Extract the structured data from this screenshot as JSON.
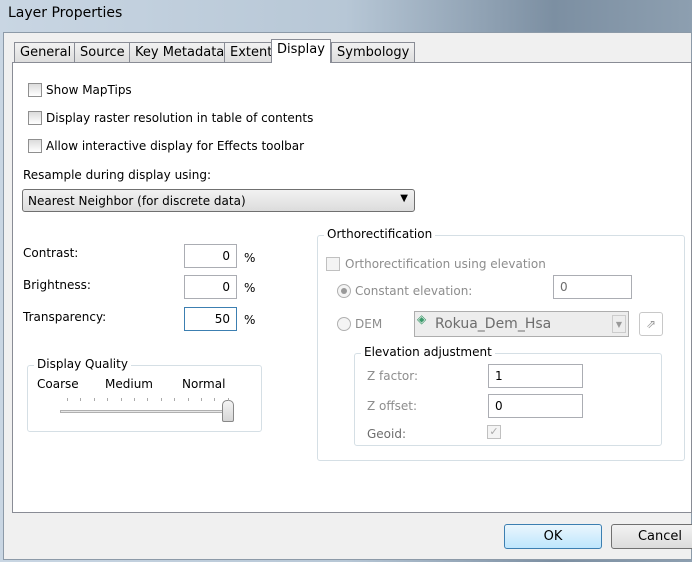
{
  "window": {
    "title": "Layer Properties"
  },
  "tabs": [
    {
      "label": "General"
    },
    {
      "label": "Source"
    },
    {
      "label": "Key Metadata"
    },
    {
      "label": "Extent"
    },
    {
      "label": "Display",
      "active": true
    },
    {
      "label": "Symbology"
    }
  ],
  "checkboxes": [
    {
      "label": "Show MapTips",
      "checked": false
    },
    {
      "label": "Display raster resolution in table of contents",
      "checked": false
    },
    {
      "label": "Allow interactive display for Effects toolbar",
      "checked": false
    }
  ],
  "resample": {
    "label": "Resample during display using:",
    "value": "Nearest Neighbor (for discrete data)"
  },
  "adjust": {
    "contrast_label": "Contrast:",
    "contrast": "0",
    "brightness_label": "Brightness:",
    "brightness": "0",
    "transparency_label": "Transparency:",
    "transparency": "50",
    "unit": "%"
  },
  "quality": {
    "title": "Display Quality",
    "labels": [
      "Coarse",
      "Medium",
      "Normal"
    ],
    "value": "Normal",
    "fraction": 1.0
  },
  "ortho": {
    "title": "Orthorectification",
    "enable_label": "Orthorectification using elevation",
    "constant_label": "Constant elevation:",
    "constant_value": "0",
    "dem_label": "DEM",
    "dem_value": "Rokua_Dem_Hsa",
    "elev": {
      "title": "Elevation adjustment",
      "zfactor_label": "Z factor:",
      "zfactor": "1",
      "zoffset_label": "Z offset:",
      "zoffset": "0",
      "geoid_label": "Geoid:",
      "geoid_checked": true
    }
  },
  "buttons": {
    "ok": "OK",
    "cancel": "Cancel"
  }
}
